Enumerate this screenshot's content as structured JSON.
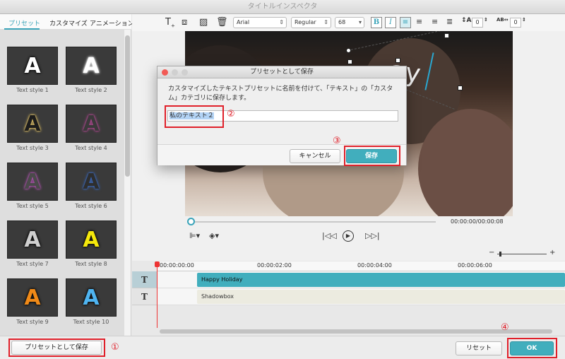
{
  "window": {
    "title": "タイトルインスペクタ"
  },
  "tabs": [
    {
      "label": "プリセット",
      "active": true
    },
    {
      "label": "カスタマイズ",
      "active": false
    },
    {
      "label": "アニメーション",
      "active": false
    }
  ],
  "presets": [
    {
      "label": "Text style 1",
      "glyph": "A",
      "color": "#ffffff",
      "glow": "#000000"
    },
    {
      "label": "Text style 2",
      "glyph": "A",
      "color": "#ffffff",
      "glow": "#ffffff"
    },
    {
      "label": "Text style 3",
      "glyph": "A",
      "color": "#1c1c1c",
      "glow": "#f5d26b"
    },
    {
      "label": "Text style 4",
      "glyph": "A",
      "color": "#3a3a3a",
      "glow": "#c54aa0"
    },
    {
      "label": "Text style 5",
      "glyph": "A",
      "color": "#4a4a4a",
      "glow": "#c054c0"
    },
    {
      "label": "Text style 6",
      "glyph": "A",
      "color": "#2e2e2e",
      "glow": "#3a6fd0"
    },
    {
      "label": "Text style 7",
      "glyph": "A",
      "color": "#cfcfcf",
      "glow": "#000000"
    },
    {
      "label": "Text style 8",
      "glyph": "A",
      "color": "#f5e80c",
      "glow": "#000000"
    },
    {
      "label": "Text style 9",
      "glyph": "A",
      "color": "#f08a18",
      "glow": "#000000"
    },
    {
      "label": "Text style 10",
      "glyph": "A",
      "color": "#4fb4f0",
      "glow": "#000000"
    }
  ],
  "toolbar": {
    "font": "Arial",
    "weight": "Regular",
    "size": "68",
    "bold": "B",
    "italic": "I",
    "spacing_value": "0",
    "kerning_value": "0"
  },
  "preview": {
    "overlay_text": "ay",
    "timecode": "00:00:00/00:00:08"
  },
  "timeline": {
    "ruler": [
      "00:00:00:00",
      "00:00:02:00",
      "00:00:04:00",
      "00:00:06:00"
    ],
    "tracks": [
      {
        "icon": "T",
        "clip": "Happy Holiday"
      },
      {
        "icon": "T",
        "clip": "Shadowbox"
      }
    ]
  },
  "dialog": {
    "title": "プリセットとして保存",
    "message": "カスタマイズしたテキストプリセットに名前を付けて、「テキスト」の「カスタム」カテゴリに保存します。",
    "input_value": "私のテキスト２",
    "cancel_label": "キャンセル",
    "save_label": "保存"
  },
  "bottom": {
    "save_preset_label": "プリセットとして保存",
    "reset_label": "リセット",
    "ok_label": "OK"
  },
  "annotations": [
    "①",
    "②",
    "③",
    "④"
  ],
  "colors": {
    "accent": "#41aebd",
    "highlight_box": "#e0202a"
  }
}
